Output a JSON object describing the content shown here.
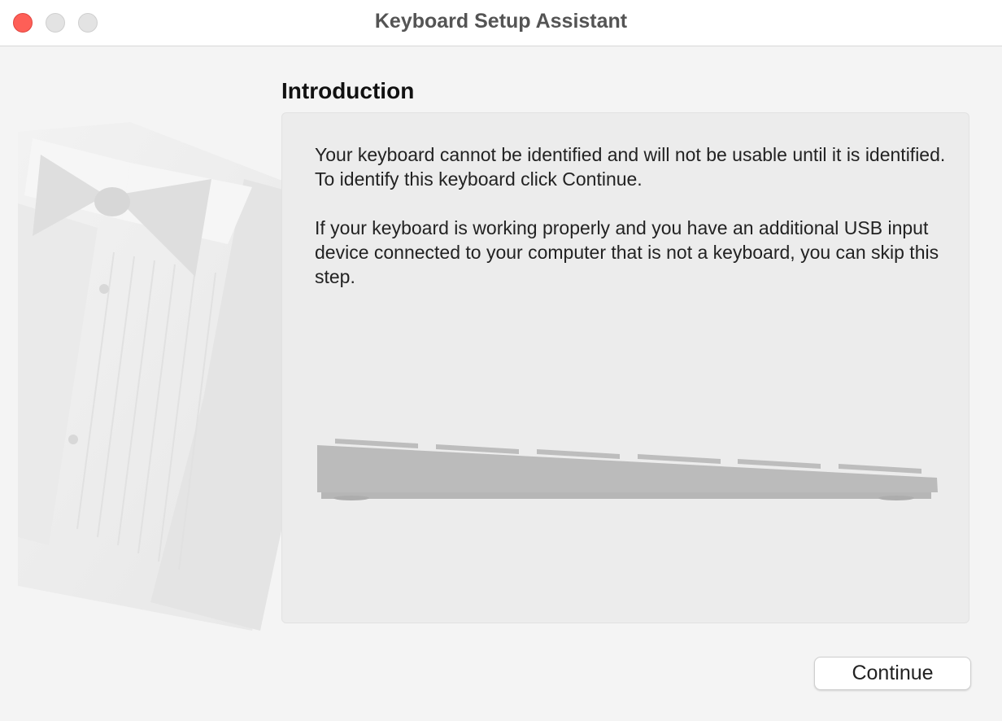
{
  "window": {
    "title": "Keyboard Setup Assistant"
  },
  "page": {
    "heading": "Introduction",
    "paragraph_1": "Your keyboard cannot be identified and will not be usable until it is identified. To identify this keyboard click Continue.",
    "paragraph_2": "If your keyboard is working properly and you have an additional USB input device connected to your computer that is not a keyboard, you can skip this step."
  },
  "buttons": {
    "continue_label": "Continue"
  },
  "colors": {
    "close": "#fe5f57",
    "window_bg": "#f4f4f4",
    "content_bg": "#ececec"
  }
}
